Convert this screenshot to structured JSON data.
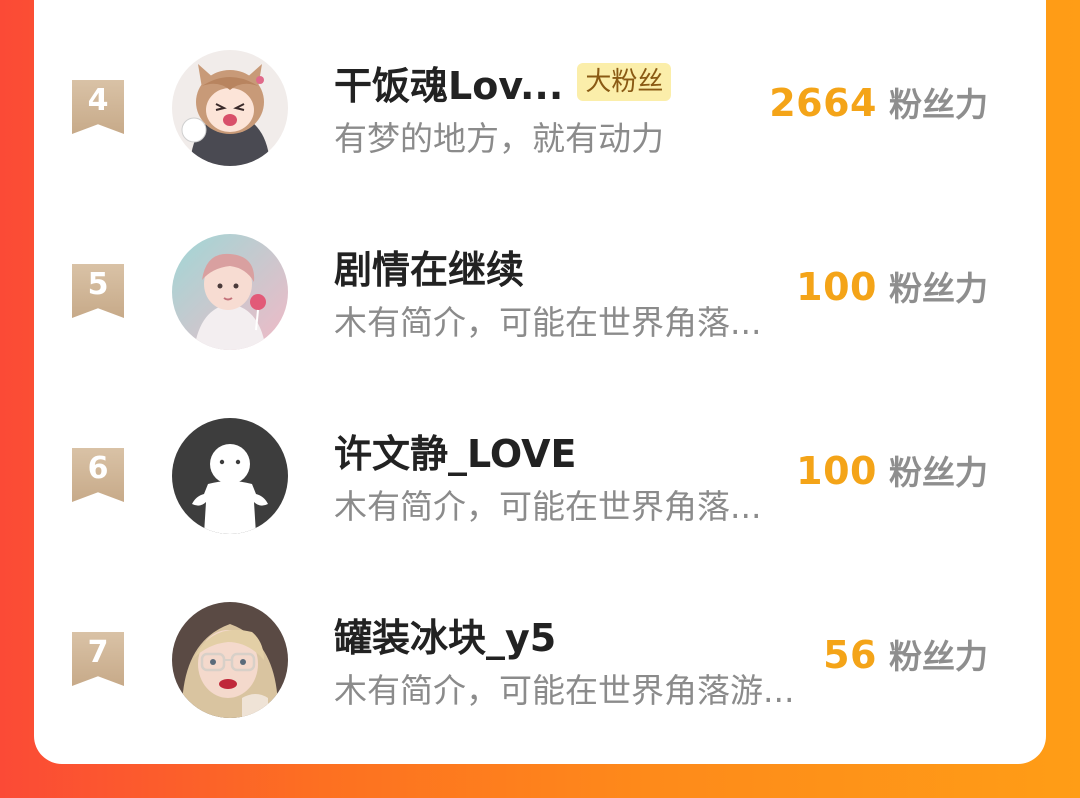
{
  "fan_unit": "粉丝力",
  "rows": [
    {
      "rank": "4",
      "name": "干饭魂Lov...",
      "badge": "大粉丝",
      "bio": "有梦的地方，就有动力",
      "score": "2664",
      "avatar": "anime-girl-avatar"
    },
    {
      "rank": "5",
      "name": "剧情在继续",
      "bio": "木有简介，可能在世界角落...",
      "score": "100",
      "avatar": "pastel-boy-avatar"
    },
    {
      "rank": "6",
      "name": "许文静_LOVE",
      "bio": "木有简介，可能在世界角落...",
      "score": "100",
      "avatar": "default-user-avatar"
    },
    {
      "rank": "7",
      "name": "罐装冰块_y5",
      "bio": "木有简介，可能在世界角落游...",
      "score": "56",
      "avatar": "blonde-girl-avatar"
    }
  ],
  "colors": {
    "score": "#f4a418",
    "rank_badge": "#cbb091",
    "badge_bg": "#fbeeaa",
    "background_gradient_start": "#fb4a36",
    "background_gradient_end": "#ff9d16"
  }
}
